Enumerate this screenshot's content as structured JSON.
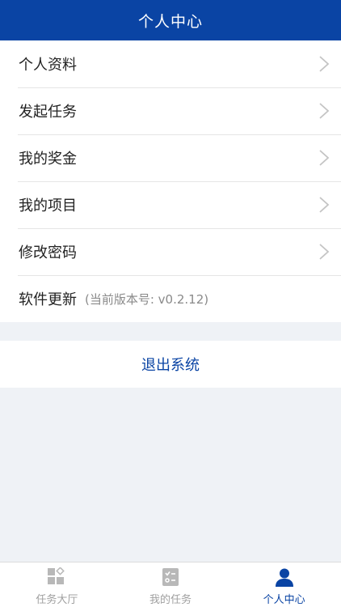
{
  "header": {
    "title": "个人中心"
  },
  "menu": {
    "items": [
      {
        "label": "个人资料"
      },
      {
        "label": "发起任务"
      },
      {
        "label": "我的奖金"
      },
      {
        "label": "我的项目"
      },
      {
        "label": "修改密码"
      }
    ],
    "update": {
      "label": "软件更新",
      "version_note": "(当前版本号: v0.2.12)"
    }
  },
  "logout": {
    "label": "退出系统"
  },
  "tabbar": {
    "tabs": [
      {
        "label": "任务大厅",
        "icon": "grid-icon"
      },
      {
        "label": "我的任务",
        "icon": "checklist-icon"
      },
      {
        "label": "个人中心",
        "icon": "user-icon"
      }
    ],
    "active_index": 2
  },
  "colors": {
    "brand": "#0a44a4",
    "background": "#eff2f6",
    "inactive": "#a0a0a0"
  }
}
